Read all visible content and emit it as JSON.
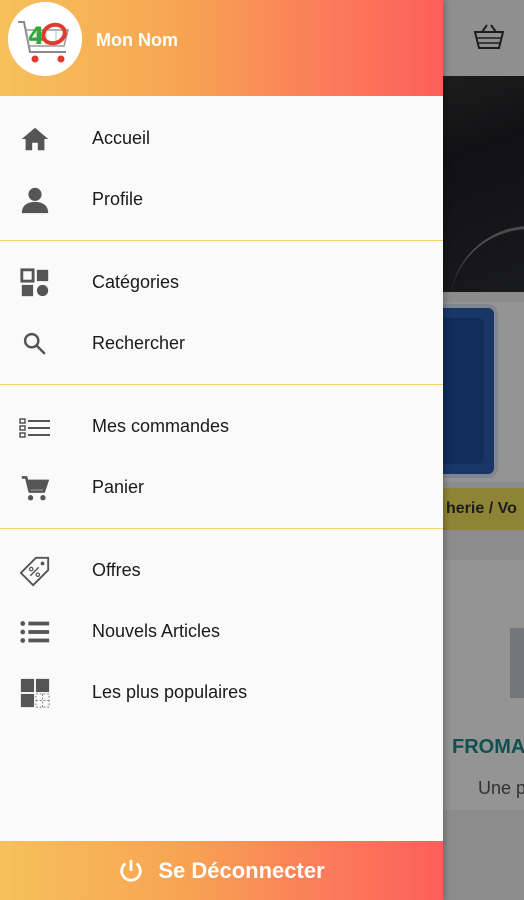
{
  "app": {
    "username": "Mon Nom"
  },
  "menu_groups": [
    [
      {
        "label": "Accueil",
        "icon": "home-icon"
      },
      {
        "label": "Profile",
        "icon": "person-icon"
      }
    ],
    [
      {
        "label": "Catégories",
        "icon": "categories-icon"
      },
      {
        "label": "Rechercher",
        "icon": "search-icon"
      }
    ],
    [
      {
        "label": "Mes commandes",
        "icon": "orders-list-icon"
      },
      {
        "label": "Panier",
        "icon": "cart-icon"
      }
    ],
    [
      {
        "label": "Offres",
        "icon": "offer-tag-icon"
      },
      {
        "label": "Nouvels Articles",
        "icon": "list-icon"
      },
      {
        "label": "Les plus populaires",
        "icon": "popular-grid-icon"
      }
    ]
  ],
  "logout": {
    "label": "Se Déconnecter",
    "icon": "power-icon"
  },
  "background": {
    "category_strip_text": "herie / Vo",
    "product_title": "FROMA",
    "product_subtitle": "Une p"
  },
  "colors": {
    "accent_start": "#f6c15a",
    "accent_end": "#fd5f5a",
    "divider": "#f0d36a"
  }
}
